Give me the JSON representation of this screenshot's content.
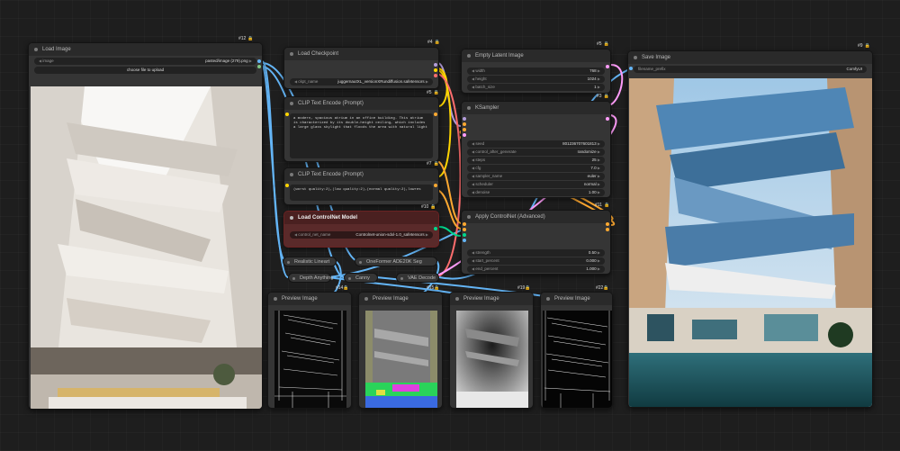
{
  "nodes": {
    "load_image": {
      "title": "Load Image",
      "id": "#12",
      "image_label": "image",
      "image_value": "pasted/image (279).png",
      "upload_label": "choose file to upload"
    },
    "load_checkpoint": {
      "title": "Load Checkpoint",
      "id": "#4",
      "ckpt_label": "ckpt_name",
      "ckpt_value": "juggernautXL_versionXRundiffusion.safetensors"
    },
    "empty_latent": {
      "title": "Empty Latent Image",
      "id": "#5",
      "width_label": "width",
      "width_value": "768",
      "height_label": "height",
      "height_value": "1024",
      "batch_label": "batch_size",
      "batch_value": "1"
    },
    "save_image": {
      "title": "Save Image",
      "id": "#9",
      "prefix_label": "filename_prefix",
      "prefix_value": "ComfyUI"
    },
    "clip_pos": {
      "title": "CLIP Text Encode (Prompt)",
      "id": "#6",
      "text": "a modern, spacious atrium in an office building. This atrium is characterized by its double-height ceiling, which includes a large glass skylight that floods the area with natural light"
    },
    "clip_neg": {
      "title": "CLIP Text Encode (Prompt)",
      "id": "#7",
      "text": "(worst quality:2),(low quality:2),(normal quality:2),lowres"
    },
    "ksampler": {
      "title": "KSampler",
      "id": "#3",
      "seed_label": "seed",
      "seed_value": "801236707601813",
      "control_label": "control_after_generate",
      "control_value": "randomize",
      "steps_label": "steps",
      "steps_value": "25",
      "cfg_label": "cfg",
      "cfg_value": "7.0",
      "sampler_label": "sampler_name",
      "sampler_value": "euler",
      "scheduler_label": "scheduler",
      "scheduler_value": "normal",
      "denoise_label": "denoise",
      "denoise_value": "1.00"
    },
    "load_controlnet": {
      "title": "Load ControlNet Model",
      "id": "#10",
      "cn_label": "control_net_name",
      "cn_value": "Controlnet-union-sdxl-1.0_safetensors"
    },
    "apply_controlnet": {
      "title": "Apply ControlNet (Advanced)",
      "id": "#11",
      "strength_label": "strength",
      "strength_value": "0.50",
      "start_label": "start_percent",
      "start_value": "0.000",
      "end_label": "end_percent",
      "end_value": "1.000"
    },
    "collapsed": {
      "realistic": "Realistic Lineart",
      "oneformer": "OneFormer ADE20K Seg",
      "depth": "Depth Anything",
      "canny": "Canny",
      "vae": "VAE Decode"
    },
    "previews": [
      {
        "title": "Preview Image",
        "id": "#14"
      },
      {
        "title": "Preview Image",
        "id": "#15"
      },
      {
        "title": "Preview Image",
        "id": "#19"
      },
      {
        "title": "Preview Image",
        "id": "#22"
      }
    ]
  },
  "id_extra": {
    "ckpt_sub": "#5",
    "clip_pos_sub": "#6"
  },
  "colors": {
    "model": "#b39ddb",
    "clip": "#ffd500",
    "vae": "#ff6e6e",
    "conditioning": "#ffa931",
    "latent": "#ff9cf9",
    "image": "#64b5f6",
    "control_net": "#00d78d"
  }
}
